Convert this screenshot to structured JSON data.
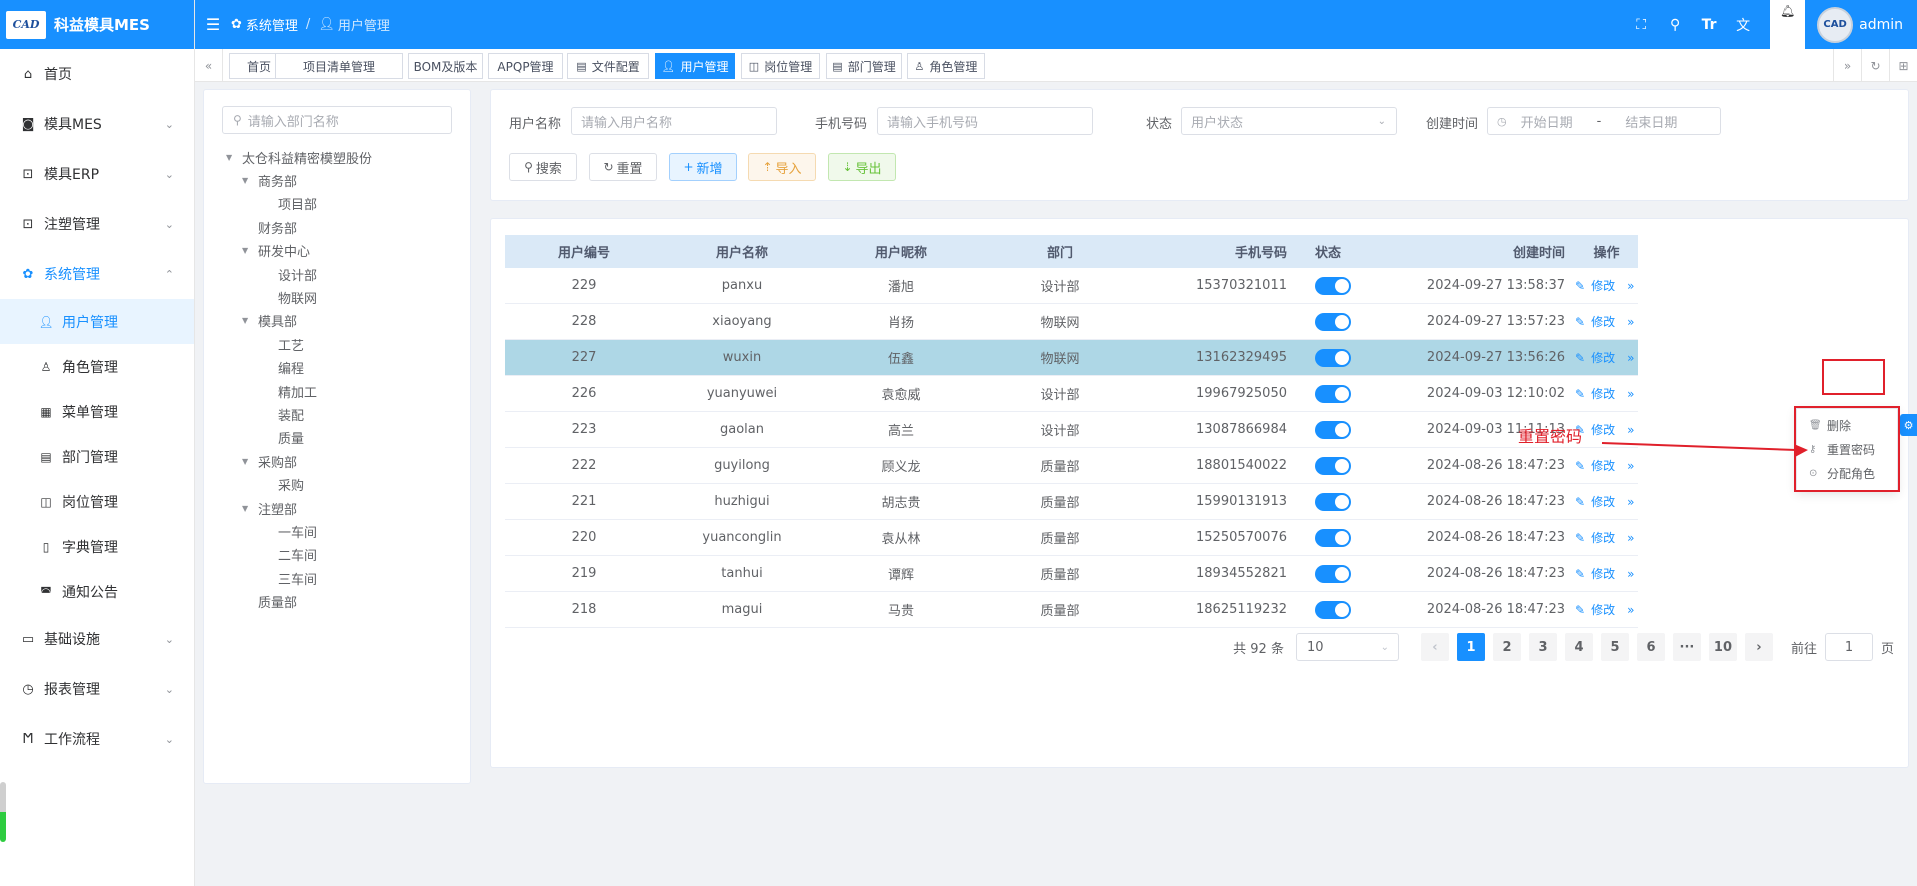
{
  "app": {
    "logo_text": "CAD",
    "title": "科益模具MES"
  },
  "header": {
    "breadcrumb": [
      "系统管理",
      "用户管理"
    ],
    "user_name": "admin",
    "avatar_text": "CAD"
  },
  "sidebar": {
    "items": [
      {
        "label": "首页",
        "icon": "home-icon",
        "arrow": false
      },
      {
        "label": "模具MES",
        "icon": "camera-icon",
        "arrow": true
      },
      {
        "label": "模具ERP",
        "icon": "bag-icon",
        "arrow": true
      },
      {
        "label": "注塑管理",
        "icon": "bag-icon",
        "arrow": true
      },
      {
        "label": "系统管理",
        "icon": "gear-icon",
        "arrow": true,
        "open": true
      },
      {
        "label": "基础设施",
        "icon": "monitor-icon",
        "arrow": true
      },
      {
        "label": "报表管理",
        "icon": "clock-icon",
        "arrow": true
      },
      {
        "label": "工作流程",
        "icon": "flow-icon",
        "arrow": true
      }
    ],
    "sub_items": [
      {
        "label": "用户管理",
        "icon": "user-icon",
        "active": true
      },
      {
        "label": "角色管理",
        "icon": "person-icon"
      },
      {
        "label": "菜单管理",
        "icon": "grid-icon"
      },
      {
        "label": "部门管理",
        "icon": "card-icon"
      },
      {
        "label": "岗位管理",
        "icon": "post-icon"
      },
      {
        "label": "字典管理",
        "icon": "book-icon"
      },
      {
        "label": "通知公告",
        "icon": "notice-icon"
      }
    ]
  },
  "tabs": [
    {
      "label": "首页",
      "icon": ""
    },
    {
      "label": "项目清单管理",
      "icon": ""
    },
    {
      "label": "BOM及版本",
      "icon": ""
    },
    {
      "label": "APQP管理",
      "icon": ""
    },
    {
      "label": "文件配置",
      "icon": "file-icon"
    },
    {
      "label": "用户管理",
      "icon": "user-icon",
      "active": true
    },
    {
      "label": "岗位管理",
      "icon": "post-icon"
    },
    {
      "label": "部门管理",
      "icon": "card-icon"
    },
    {
      "label": "角色管理",
      "icon": "person-icon"
    }
  ],
  "dept_tree": {
    "search_placeholder": "请输入部门名称",
    "nodes": [
      {
        "label": "太仓科益精密模塑股份",
        "level": 0,
        "expanded": true
      },
      {
        "label": "商务部",
        "level": 1,
        "expanded": true
      },
      {
        "label": "项目部",
        "level": 2
      },
      {
        "label": "财务部",
        "level": 1
      },
      {
        "label": "研发中心",
        "level": 1,
        "expanded": true
      },
      {
        "label": "设计部",
        "level": 2
      },
      {
        "label": "物联网",
        "level": 2
      },
      {
        "label": "模具部",
        "level": 1,
        "expanded": true
      },
      {
        "label": "工艺",
        "level": 2
      },
      {
        "label": "编程",
        "level": 2
      },
      {
        "label": "精加工",
        "level": 2
      },
      {
        "label": "装配",
        "level": 2
      },
      {
        "label": "质量",
        "level": 2
      },
      {
        "label": "采购部",
        "level": 1,
        "expanded": true
      },
      {
        "label": "采购",
        "level": 2
      },
      {
        "label": "注塑部",
        "level": 1,
        "expanded": true
      },
      {
        "label": "一车间",
        "level": 2
      },
      {
        "label": "二车间",
        "level": 2
      },
      {
        "label": "三车间",
        "level": 2
      },
      {
        "label": "质量部",
        "level": 1
      }
    ]
  },
  "filters": {
    "username_label": "用户名称",
    "username_placeholder": "请输入用户名称",
    "phone_label": "手机号码",
    "phone_placeholder": "请输入手机号码",
    "status_label": "状态",
    "status_placeholder": "用户状态",
    "created_label": "创建时间",
    "start_placeholder": "开始日期",
    "range_sep": "-",
    "end_placeholder": "结束日期"
  },
  "buttons": {
    "search": "搜索",
    "reset": "重置",
    "add": "新增",
    "import": "导入",
    "export": "导出"
  },
  "table": {
    "columns": [
      "用户编号",
      "用户名称",
      "用户昵称",
      "部门",
      "手机号码",
      "状态",
      "创建时间",
      "操作"
    ],
    "edit_label": "修改",
    "more_label": "更多",
    "rows": [
      {
        "id": "229",
        "username": "panxu",
        "nickname": "潘旭",
        "dept": "设计部",
        "phone": "15370321011",
        "created": "2024-09-27 13:58:37"
      },
      {
        "id": "228",
        "username": "xiaoyang",
        "nickname": "肖扬",
        "dept": "物联网",
        "phone": "",
        "created": "2024-09-27 13:57:23"
      },
      {
        "id": "227",
        "username": "wuxin",
        "nickname": "伍鑫",
        "dept": "物联网",
        "phone": "13162329495",
        "created": "2024-09-27 13:56:26"
      },
      {
        "id": "226",
        "username": "yuanyuwei",
        "nickname": "袁愈威",
        "dept": "设计部",
        "phone": "19967925050",
        "created": "2024-09-03 12:10:02"
      },
      {
        "id": "223",
        "username": "gaolan",
        "nickname": "高兰",
        "dept": "设计部",
        "phone": "13087866984",
        "created": "2024-09-03 11:11:13"
      },
      {
        "id": "222",
        "username": "guyilong",
        "nickname": "顾义龙",
        "dept": "质量部",
        "phone": "18801540022",
        "created": "2024-08-26 18:47:23"
      },
      {
        "id": "221",
        "username": "huzhigui",
        "nickname": "胡志贵",
        "dept": "质量部",
        "phone": "15990131913",
        "created": "2024-08-26 18:47:23"
      },
      {
        "id": "220",
        "username": "yuanconglin",
        "nickname": "袁从林",
        "dept": "质量部",
        "phone": "15250570076",
        "created": "2024-08-26 18:47:23"
      },
      {
        "id": "219",
        "username": "tanhui",
        "nickname": "谭辉",
        "dept": "质量部",
        "phone": "18934552821",
        "created": "2024-08-26 18:47:23"
      },
      {
        "id": "218",
        "username": "magui",
        "nickname": "马贵",
        "dept": "质量部",
        "phone": "18625119232",
        "created": "2024-08-26 18:47:23"
      }
    ]
  },
  "pagination": {
    "total": "共 92 条",
    "page_size": "10",
    "pages": [
      "1",
      "2",
      "3",
      "4",
      "5",
      "6",
      "···",
      "10"
    ],
    "current": "1",
    "goto_label": "前往",
    "goto_value": "1",
    "page_suffix": "页"
  },
  "dropdown": {
    "items": [
      {
        "label": "删除",
        "icon": "trash-icon"
      },
      {
        "label": "重置密码",
        "icon": "key-icon"
      },
      {
        "label": "分配角色",
        "icon": "check-circle-icon"
      }
    ]
  },
  "annotation": {
    "text": "重置密码",
    "color": "#e0202b"
  },
  "colors": {
    "primary": "#1890ff",
    "highlight_row": "#aed7e6"
  }
}
